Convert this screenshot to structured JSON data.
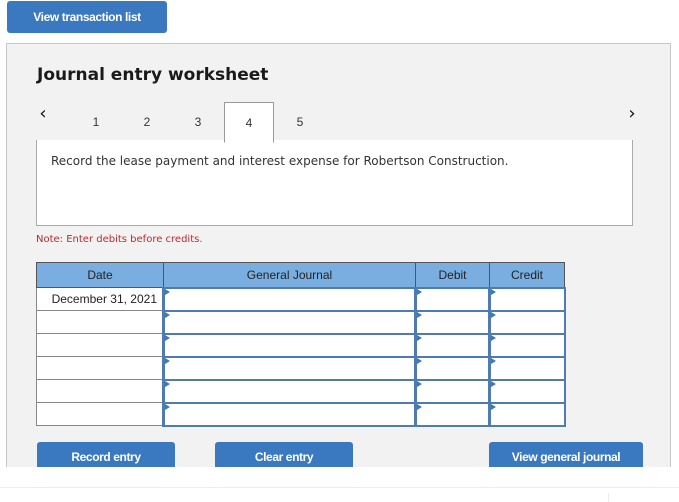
{
  "toolbar": {
    "view_transaction_list_label": "View transaction list"
  },
  "worksheet": {
    "title": "Journal entry worksheet",
    "prev_icon": "chevron-left-icon",
    "next_icon": "chevron-right-icon",
    "tabs": [
      {
        "label": "1",
        "active": false
      },
      {
        "label": "2",
        "active": false
      },
      {
        "label": "3",
        "active": false
      },
      {
        "label": "4",
        "active": true
      },
      {
        "label": "5",
        "active": false
      }
    ],
    "instruction": "Record the lease payment and interest expense for Robertson Construction.",
    "note": "Note: Enter debits before credits.",
    "colors": {
      "accent": "#3a78c0",
      "header_bg": "#7aaee0",
      "note": "#c0282d",
      "panel_bg": "#f2f2f2"
    }
  },
  "table": {
    "headers": {
      "date": "Date",
      "general_journal": "General Journal",
      "debit": "Debit",
      "credit": "Credit"
    },
    "rows": [
      {
        "date": "December 31, 2021",
        "account": "",
        "debit": "",
        "credit": ""
      },
      {
        "date": "",
        "account": "",
        "debit": "",
        "credit": ""
      },
      {
        "date": "",
        "account": "",
        "debit": "",
        "credit": ""
      },
      {
        "date": "",
        "account": "",
        "debit": "",
        "credit": ""
      },
      {
        "date": "",
        "account": "",
        "debit": "",
        "credit": ""
      },
      {
        "date": "",
        "account": "",
        "debit": "",
        "credit": ""
      }
    ]
  },
  "actions": {
    "record_entry_label": "Record entry",
    "clear_entry_label": "Clear entry",
    "view_general_journal_label": "View general journal"
  }
}
